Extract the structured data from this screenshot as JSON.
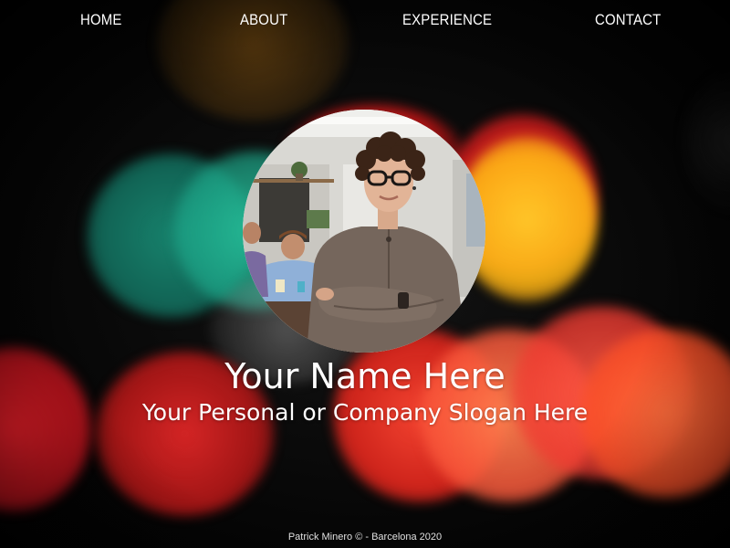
{
  "nav": {
    "items": [
      {
        "label": "HOME"
      },
      {
        "label": "ABOUT"
      },
      {
        "label": "EXPERIENCE"
      },
      {
        "label": "CONTACT"
      }
    ]
  },
  "hero": {
    "name": "Your Name Here",
    "slogan": "Your Personal or Company Slogan Here",
    "photo_icon": "profile-photo"
  },
  "footer": {
    "text": "Patrick Minero © - Barcelona 2020"
  },
  "colors": {
    "text": "#ffffff",
    "background": "#050505",
    "bokeh_red": "#e62828",
    "bokeh_yellow": "#ffc828",
    "bokeh_teal": "#1e9680"
  }
}
